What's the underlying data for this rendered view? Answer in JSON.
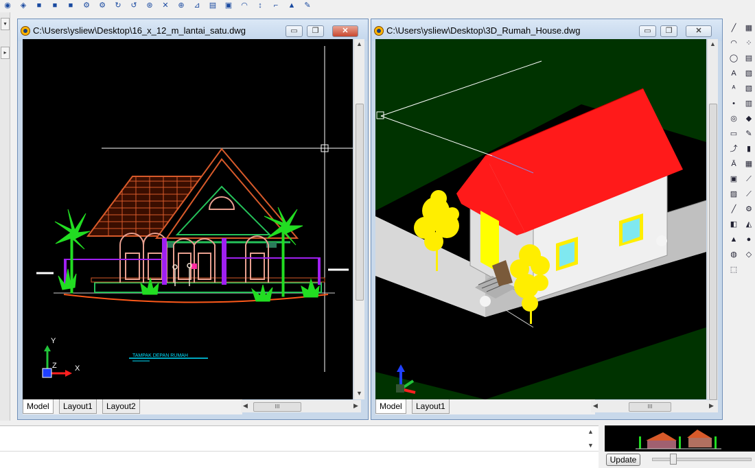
{
  "windows": [
    {
      "title": "C:\\Users\\ysliew\\Desktop\\16_x_12_m_lantai_satu.dwg",
      "tabs": [
        "Model",
        "Layout1",
        "Layout2"
      ],
      "active_tab": "Model",
      "drawing_caption": "TAMPAK DEPAN RUMAH",
      "axis_y": "Y",
      "axis_x": "X",
      "axis_z": "Z"
    },
    {
      "title": "C:\\Users\\ysliew\\Desktop\\3D_Rumah_House.dwg",
      "tabs": [
        "Model",
        "Layout1"
      ],
      "active_tab": "Model"
    }
  ],
  "window_buttons": {
    "minimize": "▭",
    "restore": "❐",
    "close": "✕"
  },
  "command_line": {
    "text": ""
  },
  "preview_panel": {
    "update_button": "Update"
  },
  "icons": {
    "toolbar": [
      "zoom-icon",
      "3d-box-icon",
      "cube-icon",
      "cube-icon",
      "cube-icon",
      "gear-icon",
      "gear-icon",
      "rotate-icon",
      "redo-icon",
      "orbit-icon",
      "delete-icon",
      "snap-icon",
      "measure-icon",
      "layer-icon",
      "image-icon",
      "arc-icon",
      "dimension-icon",
      "fillet-icon",
      "extrude-icon",
      "pen-icon"
    ],
    "right_toolbar": [
      "line-icon",
      "grid-icon",
      "arc-icon",
      "dots-icon",
      "circle-icon",
      "layer-icon",
      "text-icon",
      "block-icon",
      "small-text-icon",
      "block-icon",
      "point-icon",
      "layers-icon",
      "eye-icon",
      "tag-icon",
      "rectangle-icon",
      "pen-icon",
      "polyline-icon",
      "fill-icon",
      "text-style-icon",
      "table-icon",
      "image-icon",
      "dim-icon",
      "hatch-icon",
      "dim-icon",
      "line-icon",
      "gear-icon",
      "box-icon",
      "wedge-icon",
      "cone-icon",
      "sphere-icon",
      "torus-icon",
      "plane-icon",
      "surface-icon"
    ]
  },
  "colors": {
    "left_bg": "#000000",
    "right_bg": "#003300",
    "roof_red": "#ff1a1a",
    "tree_yellow": "#ffee00",
    "palm_green": "#22dd22",
    "brick_orange": "#d85a2a"
  }
}
